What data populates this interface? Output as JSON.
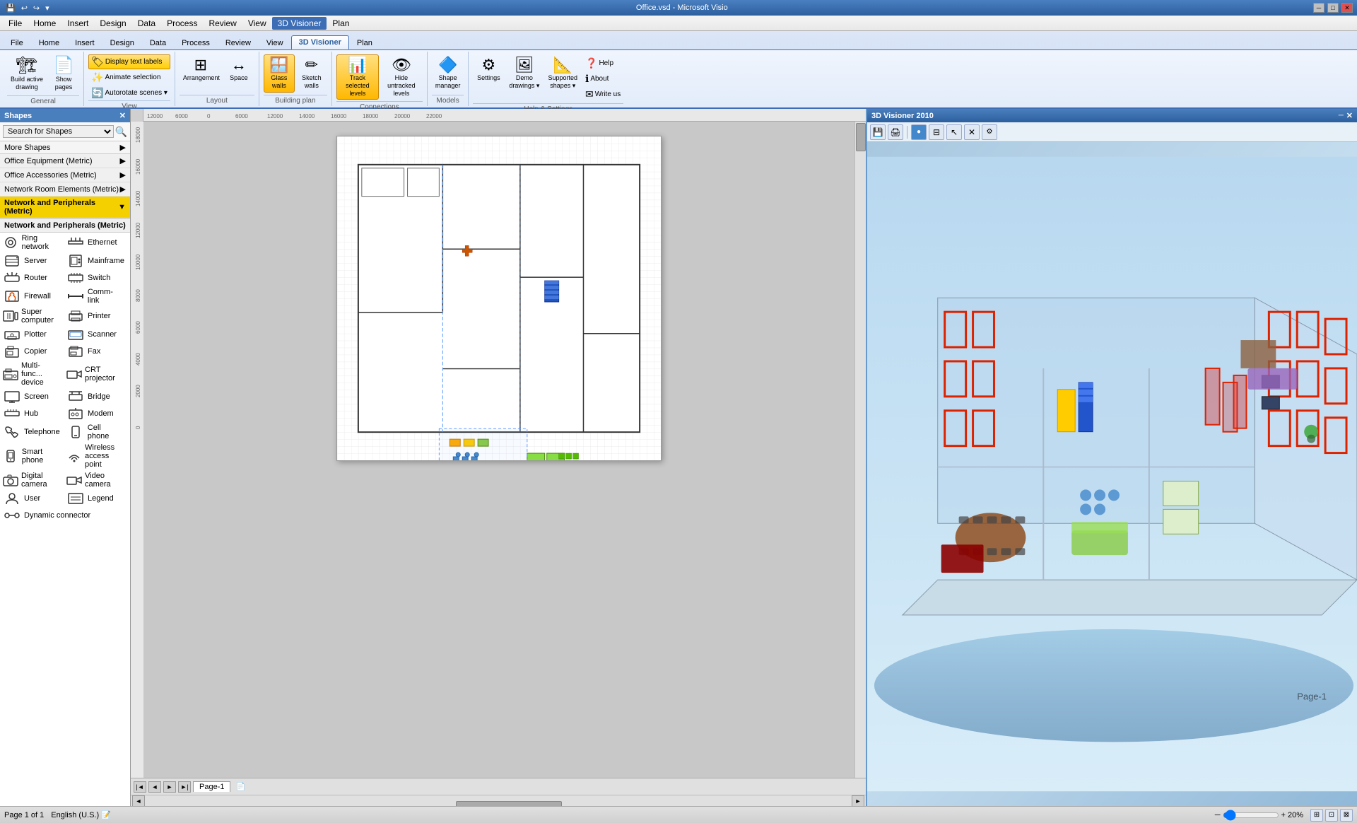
{
  "titleBar": {
    "title": "Office.vsd - Microsoft Visio",
    "closeBtn": "✕",
    "maxBtn": "□",
    "minBtn": "─"
  },
  "menuBar": {
    "items": [
      "File",
      "Home",
      "Insert",
      "Design",
      "Data",
      "Process",
      "Review",
      "View",
      "3D Visioner",
      "Plan"
    ],
    "active": "3D Visioner"
  },
  "ribbon": {
    "groups": [
      {
        "name": "General",
        "buttons": [
          {
            "id": "build-active",
            "label": "Build active\ndrawing",
            "icon": "🏗",
            "large": true
          },
          {
            "id": "show-pages",
            "label": "Show\npages",
            "icon": "📄",
            "large": true
          }
        ]
      },
      {
        "name": "View",
        "buttons": [
          {
            "id": "display-text",
            "label": "Display text labels",
            "icon": "🏷",
            "small": true,
            "active": true
          },
          {
            "id": "animate-sel",
            "label": "Animate selection",
            "icon": "✨",
            "small": true
          },
          {
            "id": "autorotate",
            "label": "Autorotate scenes ▾",
            "icon": "🔄",
            "small": true
          }
        ]
      },
      {
        "name": "Layout",
        "buttons": [
          {
            "id": "arrangement",
            "label": "Arrangement",
            "icon": "⊞",
            "large": true
          },
          {
            "id": "space",
            "label": "Space",
            "icon": "↔",
            "large": true
          }
        ]
      },
      {
        "name": "Building plan",
        "buttons": [
          {
            "id": "glass-walls",
            "label": "Glass\nwalls",
            "icon": "🪟",
            "large": true,
            "active": true
          },
          {
            "id": "sketch-walls",
            "label": "Sketch\nwalls",
            "icon": "✏",
            "large": true
          }
        ]
      },
      {
        "name": "Connections",
        "buttons": [
          {
            "id": "track-levels",
            "label": "Track selected\nlevels",
            "icon": "📊",
            "large": true,
            "active": true
          },
          {
            "id": "hide-untracked",
            "label": "Hide untracked\nlevels",
            "icon": "👁",
            "large": true
          }
        ]
      },
      {
        "name": "Models",
        "buttons": [
          {
            "id": "shape-manager",
            "label": "Shape\nmanager",
            "icon": "🔷",
            "large": true
          }
        ]
      },
      {
        "name": "Help & Settings",
        "buttons": [
          {
            "id": "settings",
            "label": "Settings",
            "icon": "⚙",
            "large": true
          },
          {
            "id": "demo-drawings",
            "label": "Demo\ndrawings ▾",
            "icon": "🖼",
            "large": true
          },
          {
            "id": "supported-shapes",
            "label": "Supported\nshapes ▾",
            "icon": "📐",
            "large": true
          },
          {
            "id": "help",
            "label": "Help",
            "icon": "❓",
            "small": true
          },
          {
            "id": "about",
            "label": "About",
            "icon": "ℹ",
            "small": true
          },
          {
            "id": "write-us",
            "label": "Write us",
            "icon": "✉",
            "small": true
          }
        ]
      }
    ]
  },
  "shapes": {
    "header": "Shapes",
    "search": {
      "placeholder": "Search for Shapes"
    },
    "moreShapes": "More Shapes",
    "categories": [
      {
        "id": "office-equip",
        "label": "Office Equipment (Metric)",
        "active": false
      },
      {
        "id": "office-acc",
        "label": "Office Accessories (Metric)",
        "active": false
      },
      {
        "id": "network-room",
        "label": "Network Room Elements (Metric)",
        "active": false
      },
      {
        "id": "network-periph",
        "label": "Network and Peripherals (Metric)",
        "active": true
      }
    ],
    "listTitle": "Network and Peripherals (Metric)",
    "items": [
      {
        "label": "Ring network",
        "icon": "⭕"
      },
      {
        "label": "Ethernet",
        "icon": "🔗"
      },
      {
        "label": "Server",
        "icon": "🖥"
      },
      {
        "label": "Mainframe",
        "icon": "🖥"
      },
      {
        "label": "Router",
        "icon": "📡"
      },
      {
        "label": "Switch",
        "icon": "🔀"
      },
      {
        "label": "Firewall",
        "icon": "🛡"
      },
      {
        "label": "Comm-link",
        "icon": "📶"
      },
      {
        "label": "Super computer",
        "icon": "💻"
      },
      {
        "label": "Printer",
        "icon": "🖨"
      },
      {
        "label": "Plotter",
        "icon": "📋"
      },
      {
        "label": "Scanner",
        "icon": "📷"
      },
      {
        "label": "Copier",
        "icon": "📠"
      },
      {
        "label": "Fax",
        "icon": "📠"
      },
      {
        "label": "Multi-func... device",
        "icon": "🖨"
      },
      {
        "label": "CRT projector",
        "icon": "📽"
      },
      {
        "label": "Screen",
        "icon": "🖥"
      },
      {
        "label": "Bridge",
        "icon": "🌉"
      },
      {
        "label": "Hub",
        "icon": "🔌"
      },
      {
        "label": "Modem",
        "icon": "📟"
      },
      {
        "label": "Telephone",
        "icon": "☎"
      },
      {
        "label": "Cell phone",
        "icon": "📱"
      },
      {
        "label": "Smart phone",
        "icon": "📱"
      },
      {
        "label": "Wireless access point",
        "icon": "📶"
      },
      {
        "label": "Digital camera",
        "icon": "📷"
      },
      {
        "label": "Video camera",
        "icon": "🎥"
      },
      {
        "label": "User",
        "icon": "👤"
      },
      {
        "label": "Legend",
        "icon": "📋"
      },
      {
        "label": "Dynamic connector",
        "icon": "➡"
      }
    ]
  },
  "panel3d": {
    "title": "3D Visioner 2010",
    "closeBtn": "✕",
    "pageLabel": "Page-1"
  },
  "statusBar": {
    "page": "Page 1 of 1",
    "language": "English (U.S.)",
    "zoom": "20%"
  },
  "pageNav": {
    "pageName": "Page-1"
  },
  "canvas": {
    "scrollH": ""
  }
}
